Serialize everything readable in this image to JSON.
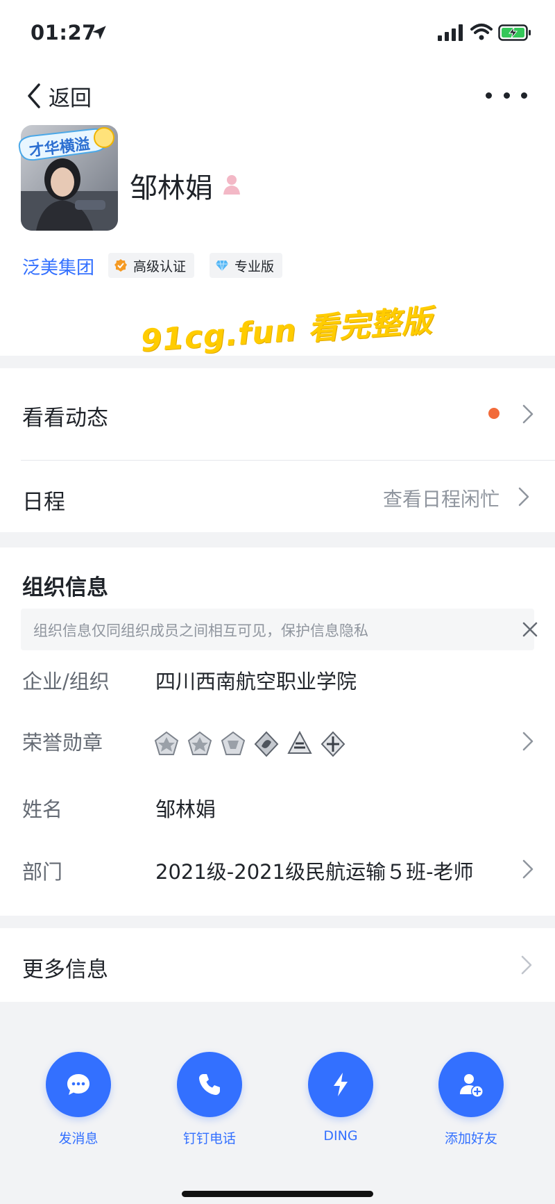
{
  "status_bar": {
    "time": "01:27"
  },
  "nav": {
    "back_label": "返回"
  },
  "profile": {
    "avatar_badge_text": "才华横溢",
    "name": "邹林娟",
    "org": "泛美集团",
    "tags": [
      "高级认证",
      "专业版"
    ]
  },
  "watermark": "91cg.fun 看完整版",
  "feed": {
    "label": "看看动态",
    "has_new": true
  },
  "schedule": {
    "label": "日程",
    "hint": "查看日程闲忙"
  },
  "org_info": {
    "title": "组织信息",
    "notice": "组织信息仅同组织成员之间相互可见，保护信息隐私",
    "rows": [
      {
        "label": "企业/组织",
        "value": "四川西南航空职业学院"
      },
      {
        "label": "荣誉勋章",
        "value": ""
      },
      {
        "label": "姓名",
        "value": "邹林娟"
      },
      {
        "label": "部门",
        "value": "2021级-2021级民航运输５班-老师"
      }
    ],
    "medals": [
      "medal-icon",
      "medal-icon",
      "medal-icon",
      "medal-icon",
      "medal-icon",
      "medal-icon"
    ]
  },
  "more": {
    "label": "更多信息"
  },
  "actions": [
    {
      "label": "发消息",
      "icon": "chat-bubble-icon"
    },
    {
      "label": "钉钉电话",
      "icon": "phone-icon"
    },
    {
      "label": "DING",
      "icon": "lightning-icon"
    },
    {
      "label": "添加好友",
      "icon": "add-friend-icon"
    }
  ],
  "colors": {
    "accent": "#3370ff",
    "dot": "#f26b3a",
    "watermark": "#ffcc00"
  }
}
